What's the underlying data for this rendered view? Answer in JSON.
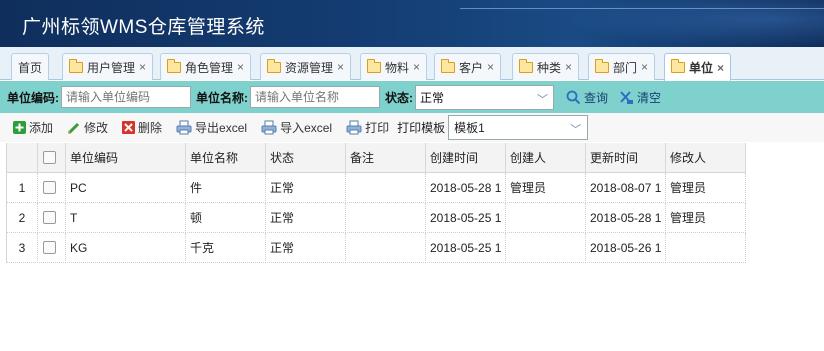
{
  "app": {
    "title": "广州标领WMS仓库管理系统"
  },
  "tabs": [
    {
      "label": "首页",
      "has_folder": false,
      "closable": false,
      "active": false
    },
    {
      "label": "用户管理",
      "has_folder": true,
      "closable": true,
      "active": false
    },
    {
      "label": "角色管理",
      "has_folder": true,
      "closable": true,
      "active": false
    },
    {
      "label": "资源管理",
      "has_folder": true,
      "closable": true,
      "active": false
    },
    {
      "label": "物料",
      "has_folder": true,
      "closable": true,
      "active": false
    },
    {
      "label": "客户",
      "has_folder": true,
      "closable": true,
      "active": false
    },
    {
      "label": "种类",
      "has_folder": true,
      "closable": true,
      "active": false
    },
    {
      "label": "部门",
      "has_folder": true,
      "closable": true,
      "active": false
    },
    {
      "label": "单位",
      "has_folder": true,
      "closable": true,
      "active": true
    }
  ],
  "close_glyph": "×",
  "search": {
    "code_label": "单位编码:",
    "code_placeholder": "请输入单位编码",
    "name_label": "单位名称:",
    "name_placeholder": "请输入单位名称",
    "status_label": "状态:",
    "status_value": "正常",
    "query_label": "查询",
    "clear_label": "清空"
  },
  "toolbar": {
    "add_label": "添加",
    "edit_label": "修改",
    "delete_label": "删除",
    "export_label": "导出excel",
    "import_label": "导入excel",
    "print_label": "打印",
    "print_template_label": "打印模板",
    "template_value": "模板1"
  },
  "table": {
    "columns": [
      "单位编码",
      "单位名称",
      "状态",
      "备注",
      "创建时间",
      "创建人",
      "更新时间",
      "修改人"
    ],
    "rows": [
      {
        "index": "1",
        "code": "PC",
        "name": "件",
        "status": "正常",
        "remark": "",
        "created": "2018-05-28 1",
        "creator": "管理员",
        "updated": "2018-08-07 1",
        "modifier": "管理员"
      },
      {
        "index": "2",
        "code": "T",
        "name": "顿",
        "status": "正常",
        "remark": "",
        "created": "2018-05-25 1",
        "creator": "",
        "updated": "2018-05-28 1",
        "modifier": "管理员"
      },
      {
        "index": "3",
        "code": "KG",
        "name": "千克",
        "status": "正常",
        "remark": "",
        "created": "2018-05-25 1",
        "creator": "",
        "updated": "2018-05-26 1",
        "modifier": ""
      }
    ]
  },
  "colors": {
    "header_bg": "#143d73",
    "search_bar_bg": "#7ed1cc",
    "add_icon": "#2e9e3a",
    "delete_icon": "#d9322b",
    "link_text": "#1b3f72"
  },
  "icons": {
    "add": "plus-icon",
    "edit": "pencil-icon",
    "delete": "delete-x-icon",
    "export": "printer-icon",
    "import": "printer-icon",
    "print": "printer-icon",
    "query": "magnifier-icon",
    "clear": "broom-icon",
    "folder": "folder-icon",
    "dropdown": "chevron-down-icon"
  }
}
